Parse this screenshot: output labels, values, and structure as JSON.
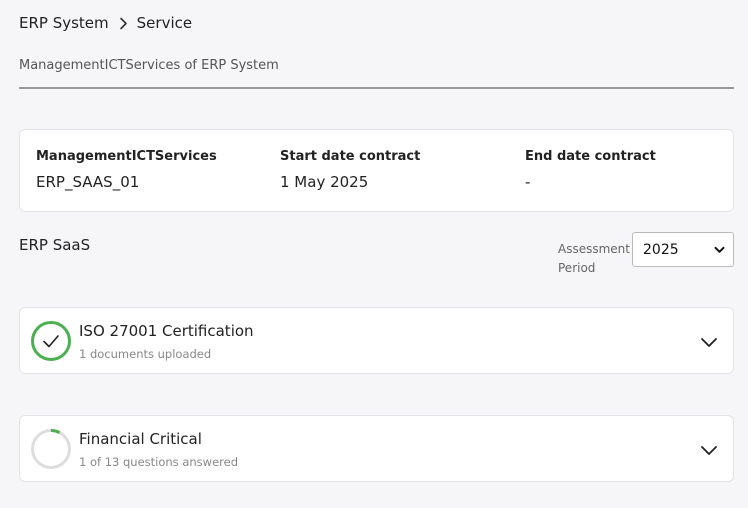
{
  "breadcrumb": {
    "items": [
      "ERP System",
      "Service"
    ]
  },
  "subtitle": "ManagementICTServices of ERP System",
  "contract": {
    "columns": [
      {
        "label": "ManagementICTServices",
        "value": "ERP_SAAS_01"
      },
      {
        "label": "Start date contract",
        "value": "1 May 2025"
      },
      {
        "label": "End date contract",
        "value": "-"
      }
    ]
  },
  "section": {
    "title": "ERP SaaS"
  },
  "assessment_period": {
    "label": "Assessment Period",
    "selected": "2025"
  },
  "assessments": [
    {
      "title": "ISO 27001 Certification",
      "meta": "1 documents uploaded",
      "status": "complete",
      "progress": 1.0,
      "color": "#4caf50"
    },
    {
      "title": "Financial Critical",
      "meta": "1 of 13 questions answered",
      "status": "in-progress",
      "progress": 0.077,
      "color": "#4caf50"
    }
  ],
  "colors": {
    "background": "#f6f5f7",
    "accent": "#4caf50",
    "ring_track": "#dddddd"
  }
}
